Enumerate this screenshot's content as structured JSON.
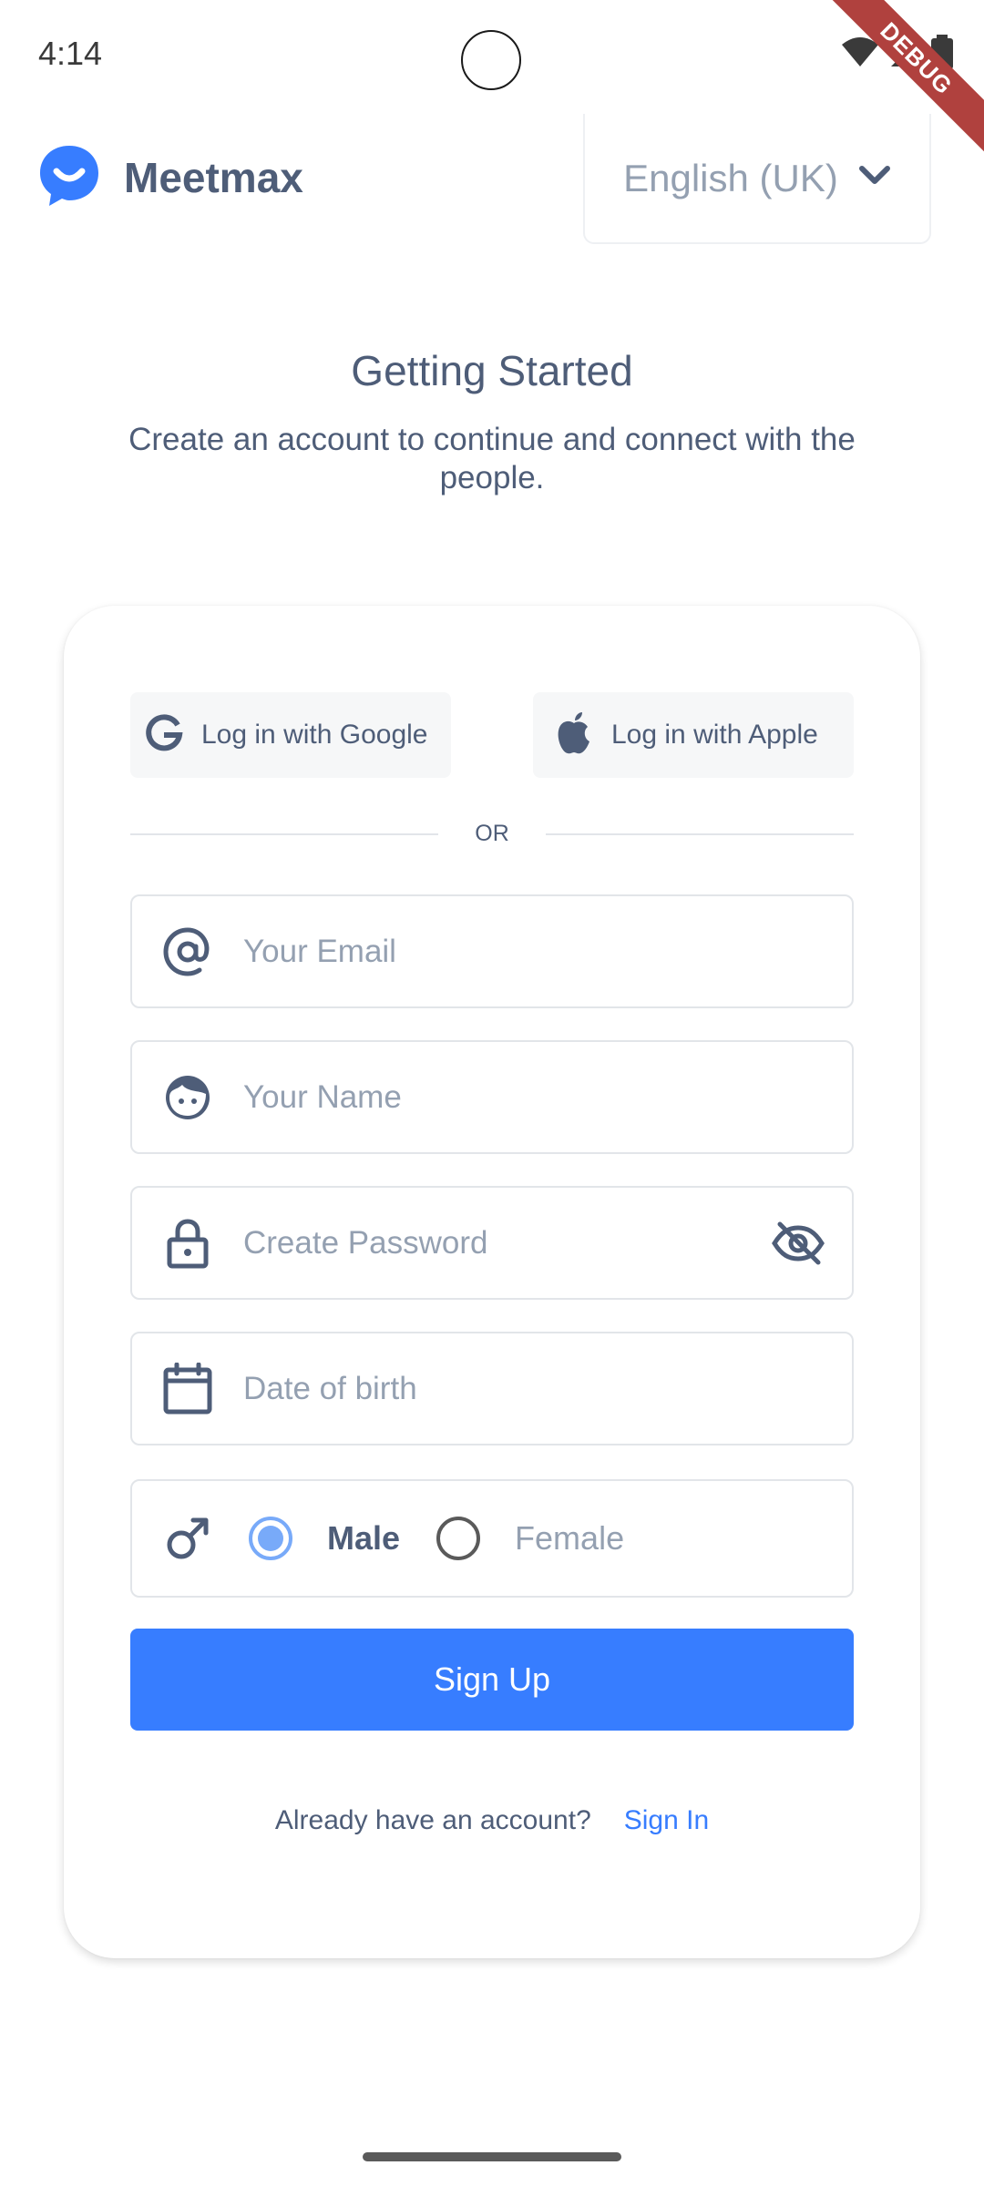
{
  "status_bar": {
    "time": "4:14"
  },
  "debug_banner": "DEBUG",
  "header": {
    "app_name": "Meetmax",
    "language": "English (UK)"
  },
  "intro": {
    "title": "Getting Started",
    "subtitle": "Create an account to continue and connect with the people."
  },
  "social": {
    "google_label": "Log in with Google",
    "apple_label": "Log in with Apple"
  },
  "divider_text": "OR",
  "form": {
    "email_placeholder": "Your Email",
    "name_placeholder": "Your Name",
    "password_placeholder": "Create Password",
    "dob_placeholder": "Date of birth",
    "gender": {
      "options": [
        "Male",
        "Female"
      ],
      "selected": "Male"
    },
    "submit_label": "Sign Up"
  },
  "footer": {
    "question": "Already have an account?",
    "link": "Sign In"
  },
  "colors": {
    "primary": "#377dff",
    "text": "#4e5d78",
    "placeholder": "#94a0b1",
    "radio_selected": "#78aaf9"
  }
}
